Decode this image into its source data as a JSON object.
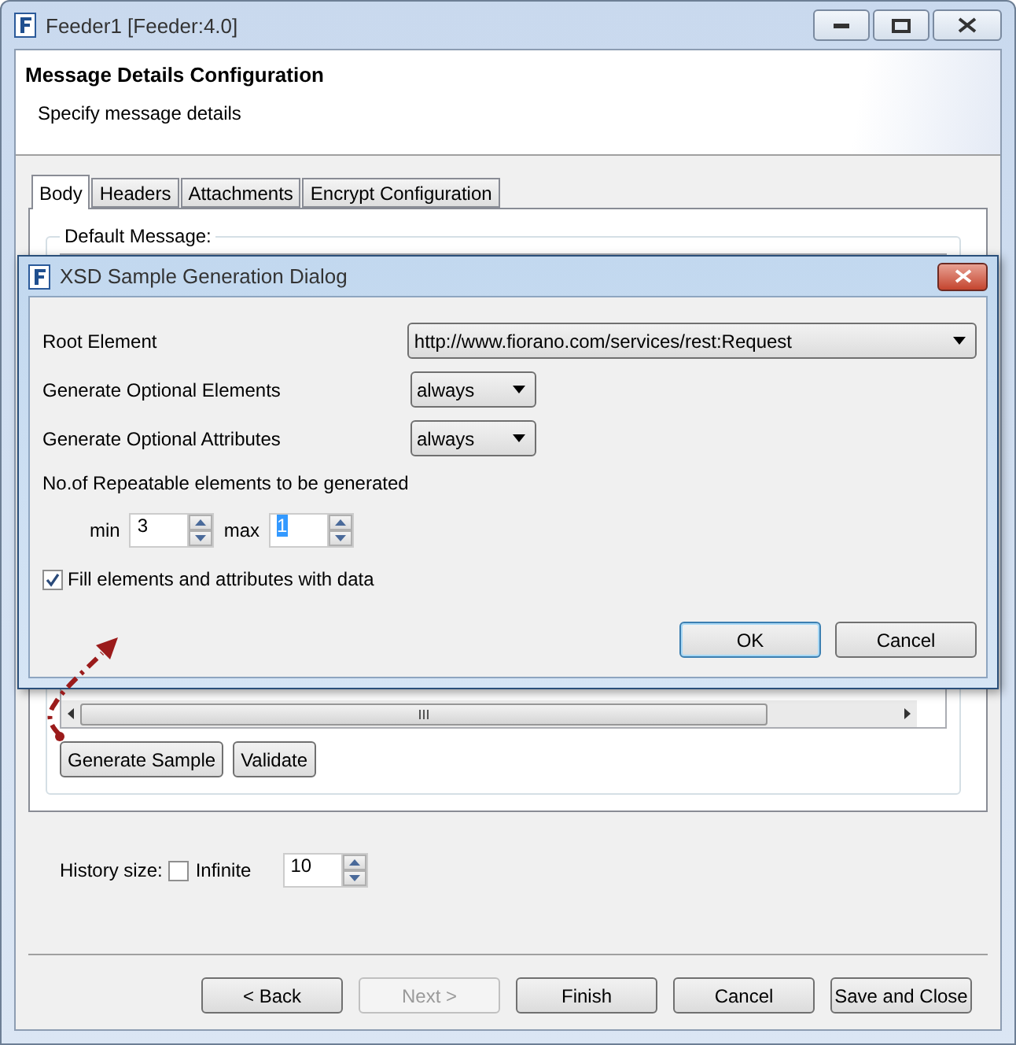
{
  "window": {
    "title": "Feeder1 [Feeder:4.0]"
  },
  "header": {
    "title": "Message Details Configuration",
    "subtitle": "Specify message details"
  },
  "tabs": [
    {
      "label": "Body",
      "selected": true
    },
    {
      "label": "Headers",
      "selected": false
    },
    {
      "label": "Attachments",
      "selected": false
    },
    {
      "label": "Encrypt Configuration",
      "selected": false
    }
  ],
  "group": {
    "label": "Default Message:"
  },
  "body_buttons": [
    "Generate Sample",
    "Validate"
  ],
  "history": {
    "label": "History size:",
    "infinite": {
      "label": "Infinite",
      "checked": false
    },
    "value": "10"
  },
  "footer_buttons": [
    {
      "label": "< Back",
      "disabled": false
    },
    {
      "label": "Next >",
      "disabled": true
    },
    {
      "label": "Finish",
      "disabled": false
    },
    {
      "label": "Cancel",
      "disabled": false
    },
    {
      "label": "Save and Close",
      "disabled": false
    }
  ],
  "dialog": {
    "title": "XSD Sample Generation Dialog",
    "rows": [
      {
        "label": "Root Element",
        "value": "http://www.fiorano.com/services/rest:Request",
        "kind": "wide"
      },
      {
        "label": "Generate Optional Elements",
        "value": "always",
        "kind": "narrow"
      },
      {
        "label": "Generate Optional Attributes",
        "value": "always",
        "kind": "narrow"
      }
    ],
    "repeat_label": "No.of Repeatable elements to be generated",
    "min": {
      "label": "min",
      "value": "3",
      "selected": false
    },
    "max": {
      "label": "max",
      "value": "1",
      "selected": true
    },
    "fill": {
      "label": "Fill elements and attributes with data",
      "checked": true
    },
    "buttons": [
      {
        "label": "OK",
        "default": true
      },
      {
        "label": "Cancel",
        "default": false
      }
    ]
  }
}
